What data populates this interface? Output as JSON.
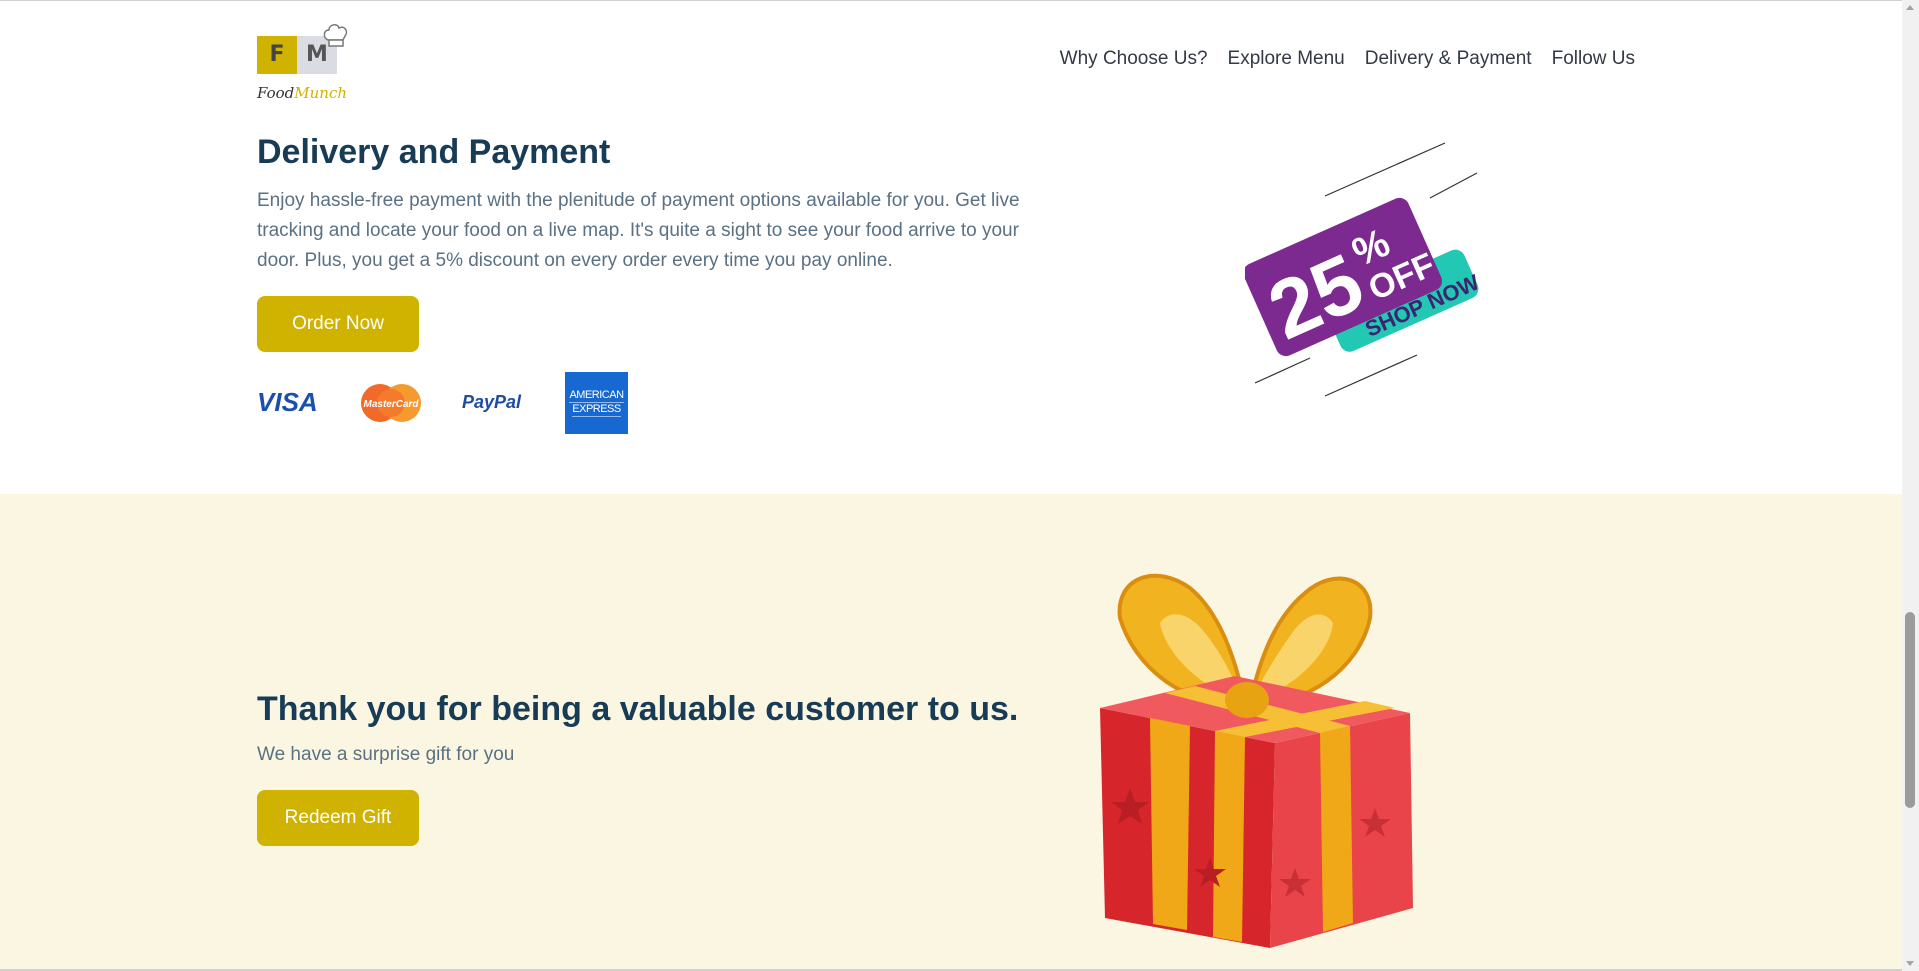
{
  "brand": {
    "logo_f": "F",
    "logo_m": "M",
    "name_part1": "Food",
    "name_part2": "Munch",
    "accent": "#d0b200"
  },
  "nav": {
    "items": [
      {
        "label": "Why Choose Us?"
      },
      {
        "label": "Explore Menu"
      },
      {
        "label": "Delivery & Payment"
      },
      {
        "label": "Follow Us"
      }
    ]
  },
  "delivery": {
    "title": "Delivery and Payment",
    "description": "Enjoy hassle-free payment with the plenitude of payment options available for you. Get live tracking and locate your food on a live map. It's quite a sight to see your food arrive to your door. Plus, you get a 5% discount on every order every time you pay online.",
    "button_label": "Order Now",
    "payment_methods": {
      "visa": "VISA",
      "mastercard": "MasterCard",
      "paypal": "PayPal",
      "amex_line1": "AMERICAN",
      "amex_line2": "EXPRESS"
    },
    "promo": {
      "number": "25",
      "percent": "%",
      "off": "OFF",
      "cta": "SHOP NOW"
    }
  },
  "thanks": {
    "title": "Thank you for being a valuable customer to us.",
    "subtitle": "We have a surprise gift for you",
    "button_label": "Redeem Gift",
    "section_bg": "#faf6e2"
  },
  "colors": {
    "heading": "#183b56",
    "body_text": "#5a7184",
    "button": "#d0b200"
  }
}
